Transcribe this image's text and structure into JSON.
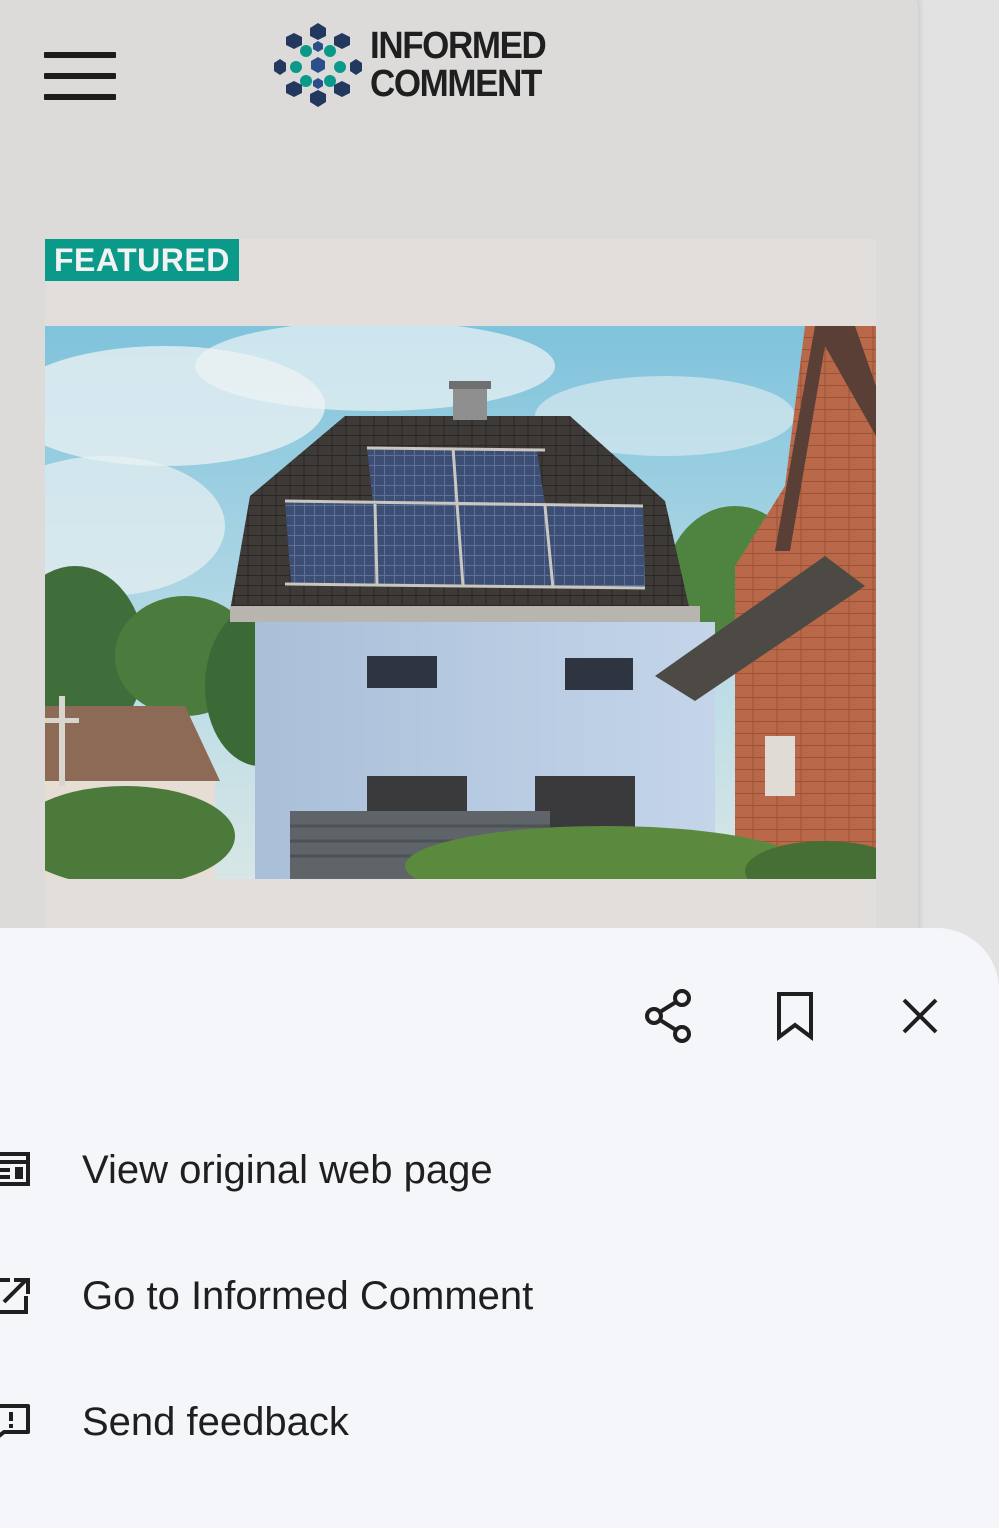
{
  "site": {
    "logo_line1": "INFORMED",
    "logo_line2": "COMMENT",
    "brand_teal": "#0b9a8a",
    "brand_navy": "#23385f"
  },
  "article": {
    "badge": "FEATURED",
    "image_alt": "House with solar panels on roof"
  },
  "sheet": {
    "actions": [
      "share-icon",
      "bookmark-icon",
      "close-icon"
    ],
    "items": [
      {
        "icon": "web-page-icon",
        "label": "View original web page"
      },
      {
        "icon": "open-external-icon",
        "label": "Go to Informed Comment"
      },
      {
        "icon": "feedback-icon",
        "label": "Send feedback"
      }
    ]
  }
}
